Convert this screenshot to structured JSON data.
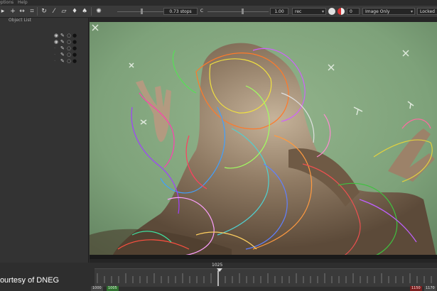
{
  "menu": {
    "items": [
      "Options",
      "Help"
    ]
  },
  "toolbar": {
    "icons": [
      "pointer-icon",
      "add-point-icon",
      "move-icon",
      "transform-box-icon",
      "rotate-icon",
      "stroke-icon",
      "crop-icon",
      "pin-icon",
      "brush-icon",
      "exposure-icon"
    ],
    "exposure_label": "0.73 stops",
    "gamma_label": "C",
    "gamma_value": "1.00",
    "colorspace": "rec",
    "frame_value": "0",
    "view_mode": "Image Only",
    "lock_state": "Locked"
  },
  "left_panel": {
    "title": "Object List",
    "row_count": 5
  },
  "timeline": {
    "playhead_frame": "1025",
    "in_frame": "1000",
    "in_frame_2": "1005",
    "out_frame": "1150",
    "out_frame_2": "1170"
  },
  "credit": "Courtesy of DNEG",
  "colors": {
    "accent_green": "#4ca64c",
    "out_red": "#c0392b",
    "panel_bg": "#333333",
    "toolbar_bg": "#3a3a3a"
  }
}
